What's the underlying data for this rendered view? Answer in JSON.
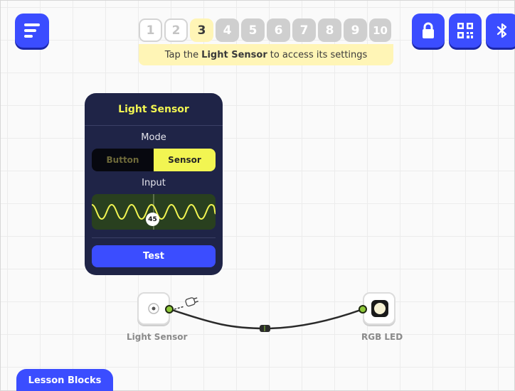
{
  "menu": {
    "icon": "hamburger-icon"
  },
  "steps": [
    {
      "label": "1",
      "state": "done"
    },
    {
      "label": "2",
      "state": "done"
    },
    {
      "label": "3",
      "state": "current"
    },
    {
      "label": "4",
      "state": "locked"
    },
    {
      "label": "5",
      "state": "locked"
    },
    {
      "label": "6",
      "state": "locked"
    },
    {
      "label": "7",
      "state": "locked"
    },
    {
      "label": "8",
      "state": "locked"
    },
    {
      "label": "9",
      "state": "locked"
    },
    {
      "label": "10",
      "state": "locked"
    }
  ],
  "hint": {
    "pre": "Tap the",
    "bold": "Light Sensor",
    "post": "to access its settings"
  },
  "toolbar": {
    "icons": [
      "lock-icon",
      "qr-code-icon",
      "bluetooth-icon"
    ]
  },
  "panel": {
    "title": "Light Sensor",
    "mode_label": "Mode",
    "mode_options": [
      "Button",
      "Sensor"
    ],
    "mode_selected": "Sensor",
    "input_label": "Input",
    "input_value": "45",
    "test_label": "Test"
  },
  "blocks": {
    "light_sensor": {
      "label": "Light Sensor"
    },
    "rgb_led": {
      "label": "RGB LED"
    }
  },
  "lesson_tab": {
    "label": "Lesson Blocks"
  },
  "colors": {
    "accent": "#3b4dff",
    "highlight": "#f2f552",
    "hint_bg": "#fff5b6",
    "panel_bg": "#1f2447",
    "port": "#8fc93a"
  }
}
